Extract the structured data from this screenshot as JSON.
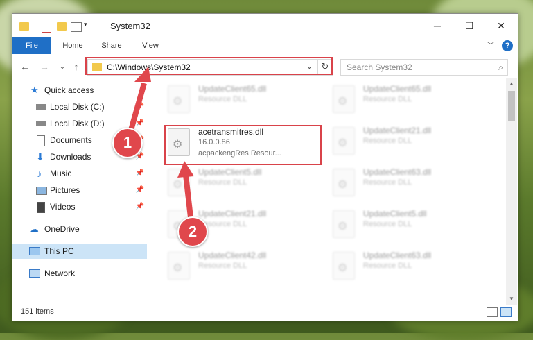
{
  "window": {
    "title": "System32",
    "caption": {
      "minimize": "─",
      "maximize": "☐",
      "close": "✕"
    }
  },
  "ribbon": {
    "tabs": [
      "File",
      "Home",
      "Share",
      "View"
    ],
    "expand": "﹀",
    "help": "?"
  },
  "nav": {
    "back": "←",
    "forward": "→",
    "recent": "⌄",
    "up": "↑"
  },
  "address": {
    "path": "C:\\Windows\\System32",
    "dropdown": "⌄",
    "refresh": "↻"
  },
  "search": {
    "placeholder": "Search System32",
    "icon": "⌕"
  },
  "navpane": {
    "items": [
      {
        "label": "Quick access",
        "icon": "star-icon",
        "pinned": false
      },
      {
        "label": "Local Disk (C:)",
        "icon": "drive-icon",
        "pinned": true
      },
      {
        "label": "Local Disk (D:)",
        "icon": "drive-icon",
        "pinned": true
      },
      {
        "label": "Documents",
        "icon": "document-icon",
        "pinned": true
      },
      {
        "label": "Downloads",
        "icon": "download-icon",
        "pinned": true
      },
      {
        "label": "Music",
        "icon": "music-icon",
        "pinned": true
      },
      {
        "label": "Pictures",
        "icon": "picture-icon",
        "pinned": true
      },
      {
        "label": "Videos",
        "icon": "video-icon",
        "pinned": true
      },
      {
        "label": "OneDrive",
        "icon": "cloud-icon",
        "pinned": false
      },
      {
        "label": "This PC",
        "icon": "computer-icon",
        "pinned": false,
        "selected": true
      },
      {
        "label": "Network",
        "icon": "network-icon",
        "pinned": false
      }
    ],
    "pin_glyph": "📌"
  },
  "files": [
    {
      "name": "UpdateClient65.dll",
      "type": "Resource DLL",
      "blurred": true
    },
    {
      "name": "UpdateClient65.dll",
      "type": "Resource DLL",
      "blurred": true
    },
    {
      "name": "acetransmitres.dll",
      "version": "16.0.0.86",
      "description": "acpackengRes Resour...",
      "blurred": false
    },
    {
      "name": "UpdateClient21.dll",
      "type": "Resource DLL",
      "blurred": true
    },
    {
      "name": "UpdateClient5.dll",
      "type": "Resource DLL",
      "blurred": true
    },
    {
      "name": "UpdateClient63.dll",
      "type": "Resource DLL",
      "blurred": true
    },
    {
      "name": "UpdateClient21.dll",
      "type": "Resource DLL",
      "blurred": true
    },
    {
      "name": "UpdateClient5.dll",
      "type": "Resource DLL",
      "blurred": true
    },
    {
      "name": "UpdateClient42.dll",
      "type": "Resource DLL",
      "blurred": true
    },
    {
      "name": "UpdateClient63.dll",
      "type": "Resource DLL",
      "blurred": true
    }
  ],
  "status": {
    "item_count": "151 items"
  },
  "callouts": {
    "one": "1",
    "two": "2"
  },
  "colors": {
    "accent": "#1f6fc6",
    "highlight": "#d9434a",
    "selected": "#cce4f7"
  }
}
